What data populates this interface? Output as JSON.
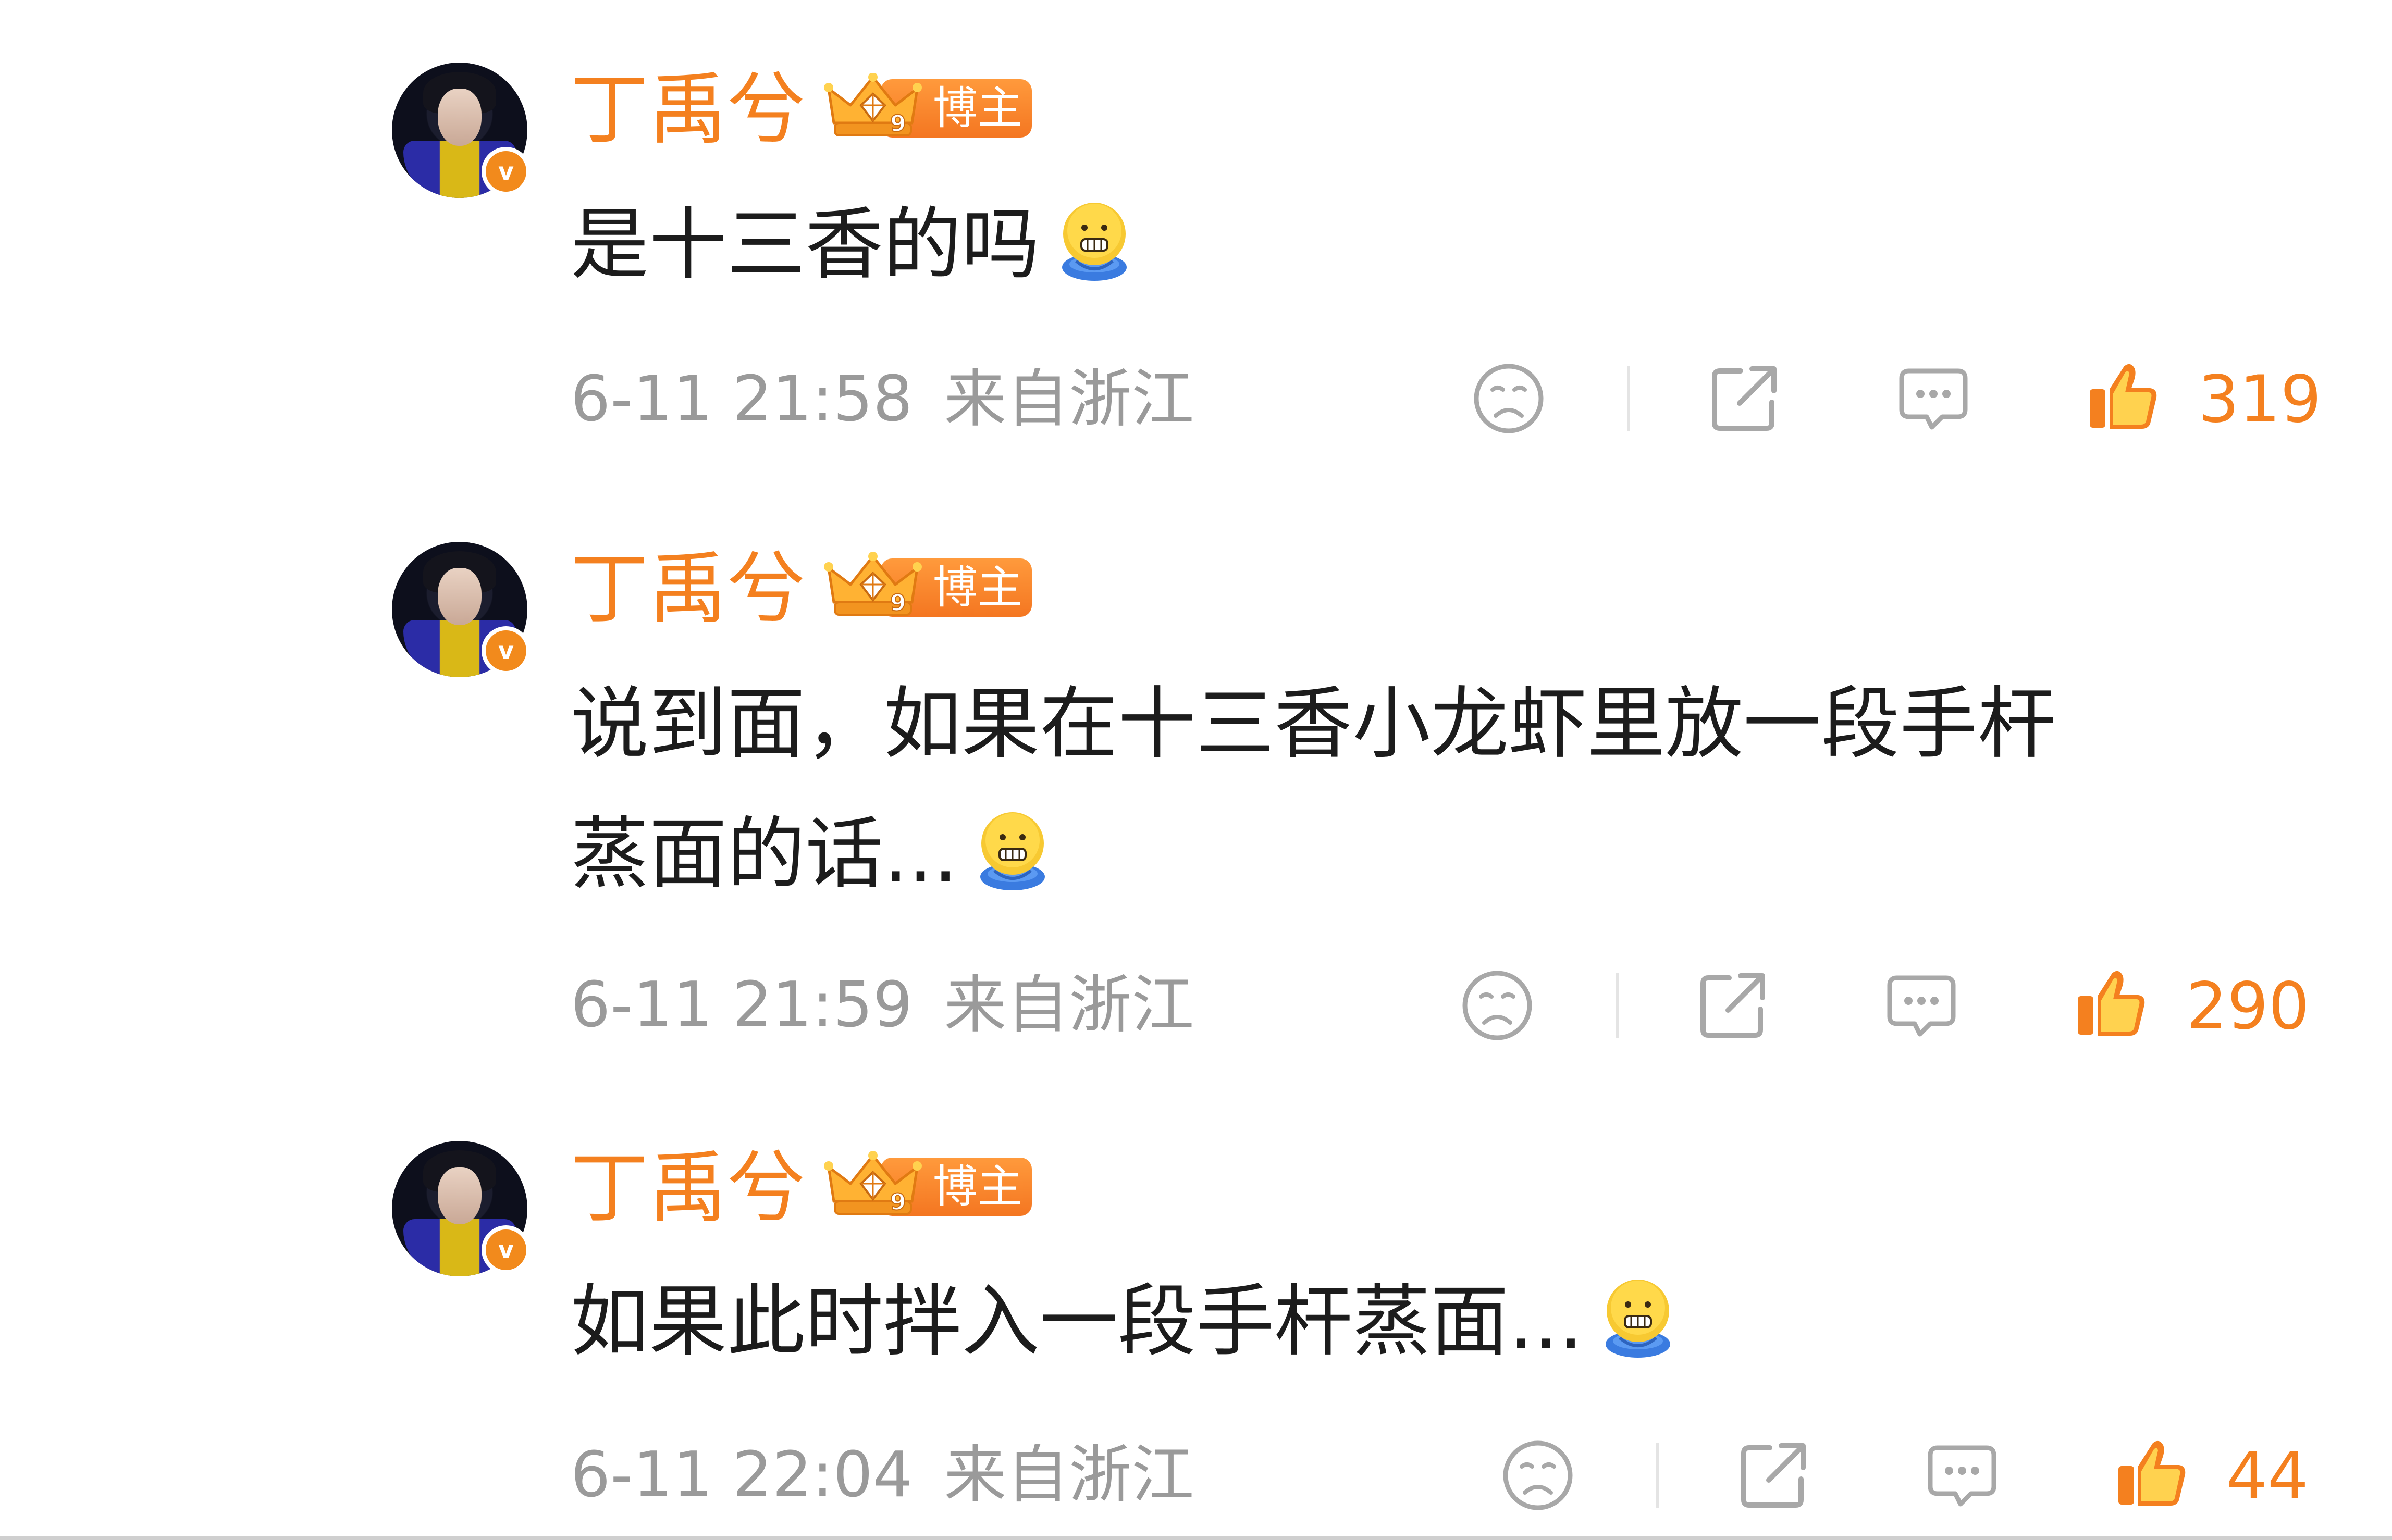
{
  "colors": {
    "accent": "#f4801f",
    "text": "#1c1c1c",
    "meta": "#9a9a9a",
    "icon": "#a8a8a8"
  },
  "badge_icon": "crown-level-9-icon",
  "comments": [
    {
      "username": "丁禹兮",
      "badge": "博主",
      "text_lines": [
        "是十三香的吗"
      ],
      "emoji": "dumpling-face-emoji",
      "time": "6-11 21:58",
      "location": "来自浙江",
      "likes": "319"
    },
    {
      "username": "丁禹兮",
      "badge": "博主",
      "text_lines": [
        "说到面，如果在十三香小龙虾里放一段手杆",
        "蒸面的话..."
      ],
      "emoji": "dumpling-face-emoji",
      "time": "6-11 21:59",
      "location": "来自浙江",
      "likes": "290"
    },
    {
      "username": "丁禹兮",
      "badge": "博主",
      "text_lines": [
        "如果此时拌入一段手杆蒸面..."
      ],
      "emoji": "dumpling-face-emoji",
      "time": "6-11 22:04",
      "location": "来自浙江",
      "likes": "44"
    }
  ]
}
